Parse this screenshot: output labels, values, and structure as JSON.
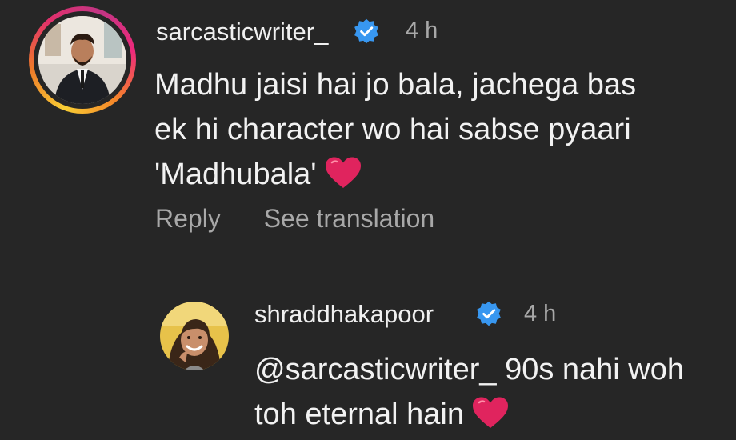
{
  "comments": [
    {
      "username": "sarcasticwriter_",
      "verified": true,
      "time": "4 h",
      "text_lines": [
        "Madhu jaisi hai jo bala, jachega bas",
        "ek hi character wo hai sabse pyaari",
        "'Madhubala'"
      ],
      "emoji": "red-heart-icon",
      "actions": {
        "reply": "Reply",
        "see_translation": "See translation"
      }
    },
    {
      "username": "shraddhakapoor",
      "verified": true,
      "time": "4 h",
      "text_lines": [
        "@sarcasticwriter_ 90s nahi woh",
        "toh eternal hain"
      ],
      "emoji": "red-heart-icon"
    }
  ],
  "colors": {
    "background": "#262626",
    "text": "#f2f2f2",
    "muted": "#a8a8a8",
    "verified_blue": "#3897f0",
    "heart_red": "#e0245e"
  }
}
